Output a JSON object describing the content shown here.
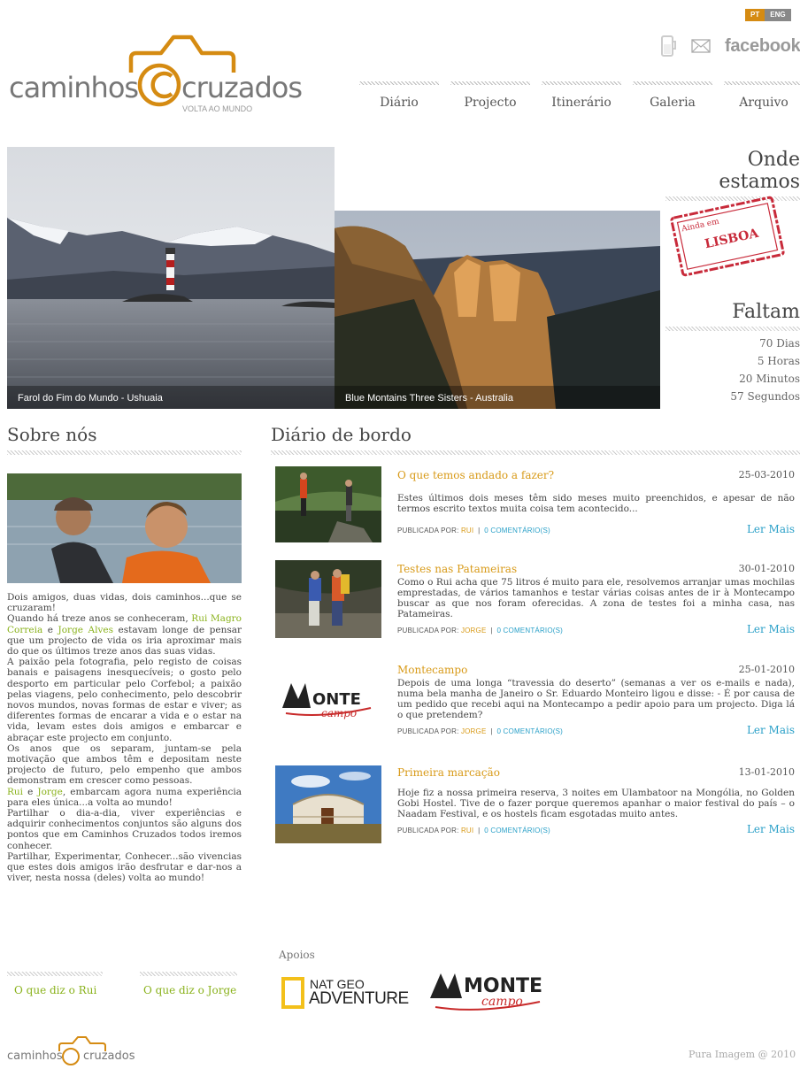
{
  "lang": {
    "pt": "PT",
    "en": "ENG"
  },
  "header": {
    "logo_left": "caminhos",
    "logo_right": "cruzados",
    "logo_sub": "VOLTA AO MUNDO",
    "facebook": "facebook"
  },
  "nav": [
    "Diário",
    "Projecto",
    "Itinerário",
    "Galeria",
    "Arquivo"
  ],
  "hero": {
    "captions": [
      "Farol do Fim do Mundo - Ushuaia",
      "Blue Montains Three Sisters - Australia"
    ]
  },
  "where": {
    "title": "Onde estamos",
    "stamp_small": "Ainda em",
    "stamp_city": "LISBOA"
  },
  "countdown": {
    "title": "Faltam",
    "lines": [
      "70 Dias",
      "5 Horas",
      "20 Minutos",
      "57 Segundos"
    ]
  },
  "about": {
    "title": "Sobre nós",
    "p1": "Dois amigos, duas vidas, dois caminhos...que se cruzaram!",
    "p2a": "Quando há treze anos se conheceram,",
    "rui_full": "Rui Magro Correia",
    "e": "e",
    "jorge_full": "Jorge Alves",
    "p2b": "estavam longe de pensar que um projecto de vida os iria aproximar mais do que os últimos treze anos das suas vidas.",
    "p3": "A paixão pela fotografia, pelo registo de coisas banais e paisagens inesquecíveis; o gosto pelo desporto em particular pelo Corfebol; a paixão pelas viagens, pelo conhecimento, pelo descobrir novos mundos, novas formas de estar e viver; as diferentes formas de encarar a vida e o estar na vida, levam estes dois amigos e embarcar e abraçar este projecto em conjunto.",
    "p4": "Os anos que os separam, juntam-se pela motivação que ambos têm e depositam neste projecto de futuro, pelo empenho que ambos demonstram em crescer como pessoas.",
    "rui": "Rui",
    "jorge": "Jorge",
    "p5": ", embarcam agora numa experiência para eles única...a volta ao mundo!",
    "p6": "Partilhar o dia-a-dia, viver experiências e adquirir conhecimentos conjuntos são alguns dos pontos que em Caminhos Cruzados todos iremos conhecer.",
    "p7": "Partilhar, Experimentar, Conhecer...são vivencias que estes dois amigos irão desfrutar e dar-nos a viver, nesta nossa (deles) volta ao mundo!",
    "link_rui": "O que diz o Rui",
    "link_jorge": "O que diz o Jorge"
  },
  "diary": {
    "title": "Diário de bordo",
    "by_label": "PUBLICADA POR:",
    "more": "Ler Mais",
    "posts": [
      {
        "title": "O que temos andado a fazer?",
        "date": "25-03-2010",
        "body": "Estes últimos dois meses têm sido meses muito preenchidos, e apesar de não termos escrito textos muita coisa tem acontecido...",
        "by": "RUI",
        "comments": "0 COMENTÁRIO(S)"
      },
      {
        "title": "Testes nas Patameiras",
        "date": "30-01-2010",
        "body": "Como o Rui acha que 75 litros é muito para ele, resolvemos arranjar umas mochilas emprestadas, de vários tamanhos e testar várias coisas antes de ir à Montecampo buscar as que nos foram oferecidas. A zona de testes foi a minha casa, nas Patameiras.",
        "by": "JORGE",
        "comments": "0 COMENTÁRIO(S)"
      },
      {
        "title": "Montecampo",
        "date": "25-01-2010",
        "body": "Depois de uma longa “travessia do deserto” (semanas a ver os e-mails e nada), numa bela manha de Janeiro o Sr. Eduardo Monteiro ligou e disse: - É por causa de um pedido que recebi aqui na Montecampo a pedir apoio para um projecto. Diga lá o que pretendem?",
        "by": "JORGE",
        "comments": "0 COMENTÁRIO(S)"
      },
      {
        "title": "Primeira marcação",
        "date": "13-01-2010",
        "body": "Hoje fiz a nossa primeira reserva, 3 noites em Ulambatoor na Mongólia, no Golden Gobi Hostel. Tive de o fazer porque queremos apanhar o maior festival do país – o Naadam Festival, e os hostels ficam esgotadas muito antes.",
        "by": "RUI",
        "comments": "0 COMENTÁRIO(S)"
      }
    ]
  },
  "sponsors": {
    "title": "Apoios",
    "natgeo_top": "NAT GEO",
    "natgeo_bottom": "ADVENTURE",
    "monte_a": "MONTE",
    "monte_b": "campo"
  },
  "footer": {
    "logo_left": "caminhos",
    "logo_right": "cruzados",
    "copyright": "Pura Imagem @ 2010"
  },
  "colors": {
    "orange": "#d58b12",
    "green": "#8ab21c",
    "blue": "#2aa0c8"
  }
}
